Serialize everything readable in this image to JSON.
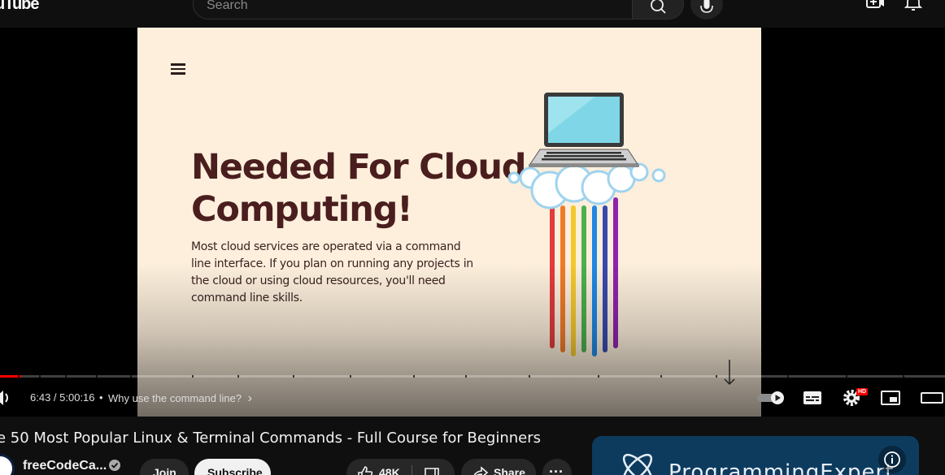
{
  "app": {
    "logo_text": "uTube",
    "search_placeholder": "Search"
  },
  "slide": {
    "title": "Needed For Cloud\nComputing!",
    "body": "Most cloud services are operated via a command line interface.  If you plan on running any projects in the cloud or using cloud resources, you'll need command line skills."
  },
  "player": {
    "time": "6:43 / 5:00:16",
    "chapter": "Why use the command line?",
    "chapter_chevron": "›",
    "separator": "•",
    "progress_fraction": 0.022,
    "hd_badge": "HD"
  },
  "video": {
    "title": "e 50 Most Popular Linux & Terminal Commands - Full Course for Beginners",
    "channel": "freeCodeCa...",
    "join_label": "Join",
    "subscribe_label": "Subscribe",
    "likes": "48K",
    "share_label": "Share",
    "more": "···"
  },
  "ad": {
    "brand": "ProgrammingExpert"
  },
  "colors": {
    "background": "#0f0f0f",
    "slide_bg": "#fdefdc",
    "slide_title": "#4a1e1e",
    "progress": "#ff0000",
    "ad_bg": "#0d3b5e"
  },
  "icons": {
    "search": "search-icon",
    "mic": "mic-icon",
    "create": "create-icon",
    "bell": "bell-icon",
    "volume": "volume-icon",
    "autoplay": "autoplay-toggle-icon",
    "subtitles": "subtitles-icon",
    "settings": "gear-icon",
    "miniplayer": "miniplayer-icon",
    "theater": "theater-mode-icon",
    "like": "thumbs-up-icon",
    "dislike": "thumbs-down-icon",
    "share": "share-icon",
    "info": "info-icon",
    "menu": "menu-icon"
  }
}
